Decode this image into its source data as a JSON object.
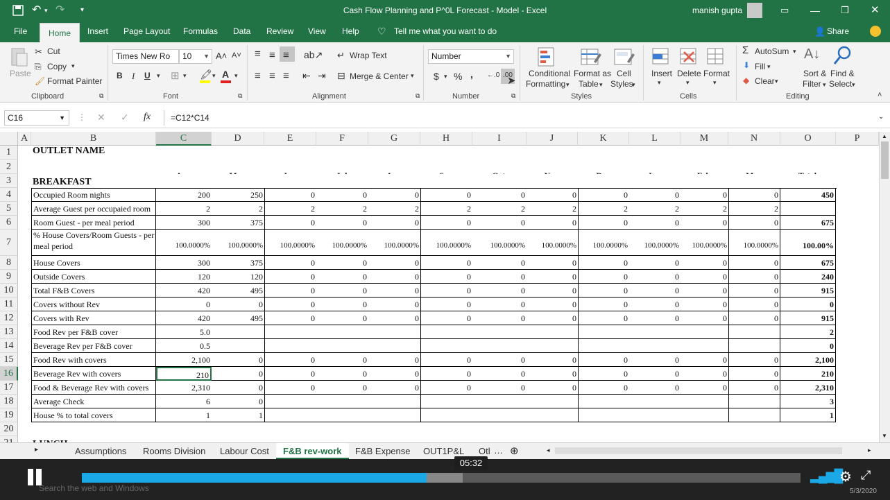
{
  "window": {
    "title": "Cash Flow Planning and P^0L Forecast - Model  -  Excel",
    "user": "manish gupta"
  },
  "menu_tabs": [
    "File",
    "Home",
    "Insert",
    "Page Layout",
    "Formulas",
    "Data",
    "Review",
    "View",
    "Help"
  ],
  "tell_me": "Tell me what you want to do",
  "share": "Share",
  "ribbon": {
    "clipboard": {
      "paste": "Paste",
      "cut": "Cut",
      "copy": "Copy",
      "format_painter": "Format Painter",
      "group": "Clipboard"
    },
    "font": {
      "name": "Times New Ro",
      "size": "10",
      "bold": "B",
      "italic": "I",
      "underline": "U",
      "group": "Font"
    },
    "alignment": {
      "wrap": "Wrap Text",
      "merge": "Merge & Center",
      "group": "Alignment"
    },
    "number": {
      "format": "Number",
      "dollar": "$",
      "percent": "%",
      "comma": ",",
      "group": "Number"
    },
    "styles": {
      "conditional": "Conditional",
      "conditional2": "Formatting",
      "format_table": "Format as",
      "format_table2": "Table",
      "cell_styles": "Cell",
      "cell_styles2": "Styles",
      "group": "Styles"
    },
    "cells": {
      "insert": "Insert",
      "delete": "Delete",
      "format": "Format",
      "group": "Cells"
    },
    "editing": {
      "autosum": "AutoSum",
      "fill": "Fill",
      "clear": "Clear",
      "sort": "Sort &",
      "sort2": "Filter",
      "find": "Find &",
      "find2": "Select",
      "group": "Editing"
    }
  },
  "formula_bar": {
    "name_box": "C16",
    "formula": "=C12*C14",
    "fx": "fx"
  },
  "columns": [
    "A",
    "B",
    "C",
    "D",
    "E",
    "F",
    "G",
    "H",
    "I",
    "J",
    "K",
    "L",
    "M",
    "N",
    "O",
    "P"
  ],
  "rows": [
    {
      "n": "1",
      "label": "OUTLET NAME",
      "vals": [
        "",
        "",
        "",
        "",
        "",
        "",
        "",
        "",
        "",
        "",
        "",
        ""
      ],
      "total": ""
    },
    {
      "n": "2",
      "label": "",
      "vals": [
        "Apr",
        "May",
        "Jun",
        "Jul",
        "Aug",
        "Sep",
        "Oct",
        "Nov",
        "Dec",
        "Jan",
        "Feb",
        "Mar"
      ],
      "total": "Total"
    },
    {
      "n": "3",
      "label": "BREAKFAST",
      "vals": [
        "",
        "",
        "",
        "",
        "",
        "",
        "",
        "",
        "",
        "",
        "",
        ""
      ],
      "total": ""
    },
    {
      "n": "4",
      "label": "Occupied Room nights",
      "vals": [
        "200",
        "250",
        "0",
        "0",
        "0",
        "0",
        "0",
        "0",
        "0",
        "0",
        "0",
        "0"
      ],
      "total": "450"
    },
    {
      "n": "5",
      "label": "Average Guest per occupaied room",
      "vals": [
        "2",
        "2",
        "2",
        "2",
        "2",
        "2",
        "2",
        "2",
        "2",
        "2",
        "2",
        "2"
      ],
      "total": ""
    },
    {
      "n": "6",
      "label": "Room Guest - per meal period",
      "vals": [
        "300",
        "375",
        "0",
        "0",
        "0",
        "0",
        "0",
        "0",
        "0",
        "0",
        "0",
        "0"
      ],
      "total": "675"
    },
    {
      "n": "7",
      "label": "% House Covers/Room Guests - per meal period",
      "vals": [
        "100.0000%",
        "100.0000%",
        "100.0000%",
        "100.0000%",
        "100.0000%",
        "100.0000%",
        "100.0000%",
        "100.0000%",
        "100.0000%",
        "100.0000%",
        "100.0000%",
        "100.0000%"
      ],
      "total": "100.00%"
    },
    {
      "n": "8",
      "label": "House Covers",
      "vals": [
        "300",
        "375",
        "0",
        "0",
        "0",
        "0",
        "0",
        "0",
        "0",
        "0",
        "0",
        "0"
      ],
      "total": "675"
    },
    {
      "n": "9",
      "label": "Outside Covers",
      "vals": [
        "120",
        "120",
        "0",
        "0",
        "0",
        "0",
        "0",
        "0",
        "0",
        "0",
        "0",
        "0"
      ],
      "total": "240"
    },
    {
      "n": "10",
      "label": "Total F&B Covers",
      "vals": [
        "420",
        "495",
        "0",
        "0",
        "0",
        "0",
        "0",
        "0",
        "0",
        "0",
        "0",
        "0"
      ],
      "total": "915"
    },
    {
      "n": "11",
      "label": "Covers without Rev",
      "vals": [
        "0",
        "0",
        "0",
        "0",
        "0",
        "0",
        "0",
        "0",
        "0",
        "0",
        "0",
        "0"
      ],
      "total": "0"
    },
    {
      "n": "12",
      "label": "Covers with Rev",
      "vals": [
        "420",
        "495",
        "0",
        "0",
        "0",
        "0",
        "0",
        "0",
        "0",
        "0",
        "0",
        "0"
      ],
      "total": "915"
    },
    {
      "n": "13",
      "label": "Food Rev per F&B cover",
      "vals": [
        "5.0",
        "",
        "",
        "",
        "",
        "",
        "",
        "",
        "",
        "",
        "",
        ""
      ],
      "total": "2"
    },
    {
      "n": "14",
      "label": "Beverage Rev per F&B cover",
      "vals": [
        "0.5",
        "",
        "",
        "",
        "",
        "",
        "",
        "",
        "",
        "",
        "",
        ""
      ],
      "total": "0"
    },
    {
      "n": "15",
      "label": "Food Rev with covers",
      "vals": [
        "2,100",
        "0",
        "0",
        "0",
        "0",
        "0",
        "0",
        "0",
        "0",
        "0",
        "0",
        "0"
      ],
      "total": "2,100"
    },
    {
      "n": "16",
      "label": "Beverage Rev with covers",
      "vals": [
        "210",
        "0",
        "0",
        "0",
        "0",
        "0",
        "0",
        "0",
        "0",
        "0",
        "0",
        "0"
      ],
      "total": "210"
    },
    {
      "n": "17",
      "label": "Food & Beverage Rev with covers",
      "vals": [
        "2,310",
        "0",
        "0",
        "0",
        "0",
        "0",
        "0",
        "0",
        "0",
        "0",
        "0",
        "0"
      ],
      "total": "2,310"
    },
    {
      "n": "18",
      "label": "Average Check",
      "vals": [
        "6",
        "0",
        "",
        "",
        "",
        "",
        "",
        "",
        "",
        "",
        "",
        ""
      ],
      "total": "3"
    },
    {
      "n": "19",
      "label": "House % to total covers",
      "vals": [
        "1",
        "1",
        "",
        "",
        "",
        "",
        "",
        "",
        "",
        "",
        "",
        ""
      ],
      "total": "1"
    },
    {
      "n": "20",
      "label": "",
      "vals": [
        "",
        "",
        "",
        "",
        "",
        "",
        "",
        "",
        "",
        "",
        "",
        ""
      ],
      "total": ""
    },
    {
      "n": "21",
      "label": "LUNCH",
      "vals": [
        "",
        "",
        "",
        "",
        "",
        "",
        "",
        "",
        "",
        "",
        "",
        ""
      ],
      "total": ""
    }
  ],
  "sheets": [
    "Assumptions",
    "Rooms Division",
    "Labour Cost",
    "F&B rev-work",
    "F&B Expense",
    "OUT1P&L",
    "Otl"
  ],
  "active_sheet": "F&B rev-work",
  "video": {
    "time": "05:32",
    "progress": 0.48,
    "buffered": 0.53
  },
  "taskbar": {
    "search": "Search the web and Windows",
    "date": "5/3/2020"
  }
}
